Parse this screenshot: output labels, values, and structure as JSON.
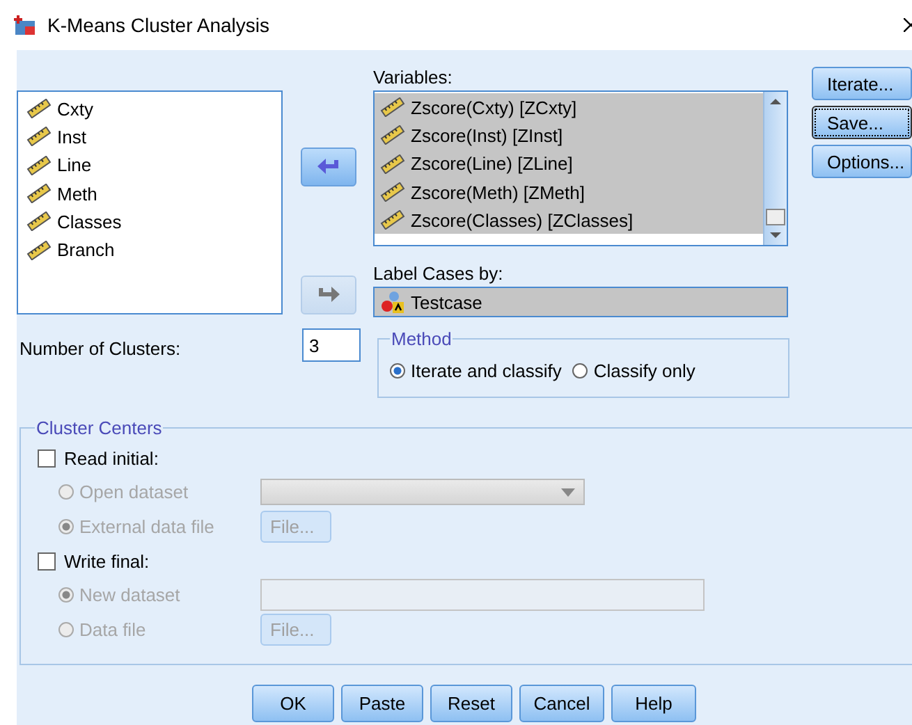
{
  "window": {
    "title": "K-Means Cluster Analysis"
  },
  "source_variables": [
    {
      "name": "Cxty"
    },
    {
      "name": "Inst"
    },
    {
      "name": "Line"
    },
    {
      "name": "Meth"
    },
    {
      "name": "Classes"
    },
    {
      "name": "Branch"
    }
  ],
  "move_buttons": [
    {
      "disabled": false
    },
    {
      "disabled": true
    }
  ],
  "variables": {
    "label": "Variables:",
    "items": [
      {
        "name": "Zscore(Cxty) [ZCxty]",
        "selected": true
      },
      {
        "name": "Zscore(Inst) [ZInst]",
        "selected": true
      },
      {
        "name": "Zscore(Line) [ZLine]",
        "selected": true
      },
      {
        "name": "Zscore(Meth) [ZMeth]",
        "selected": true
      },
      {
        "name": "Zscore(Classes) [ZClasses]",
        "selected": true
      }
    ]
  },
  "label_cases": {
    "label": "Label Cases by:",
    "value": "Testcase"
  },
  "side_buttons": [
    {
      "label": "Iterate...",
      "focused": false
    },
    {
      "label": "Save...",
      "focused": true
    },
    {
      "label": "Options...",
      "focused": false
    }
  ],
  "number_of_clusters": {
    "label": "Number of Clusters:",
    "value": "3"
  },
  "method": {
    "title": "Method",
    "options": [
      {
        "label": "Iterate and classify",
        "selected": true
      },
      {
        "label": "Classify only",
        "selected": false
      }
    ]
  },
  "cluster_centers": {
    "title": "Cluster Centers",
    "groups": [
      {
        "label": "Read initial:",
        "checked": false,
        "options": [
          {
            "label": "Open dataset",
            "selected": false,
            "disabled": true,
            "kind": "dropdown"
          },
          {
            "label": "External data file",
            "selected": true,
            "disabled": true,
            "kind": "file",
            "button": "File..."
          }
        ]
      },
      {
        "label": "Write final:",
        "checked": false,
        "options": [
          {
            "label": "New dataset",
            "selected": true,
            "disabled": true,
            "kind": "text"
          },
          {
            "label": "Data file",
            "selected": false,
            "disabled": true,
            "kind": "file",
            "button": "File..."
          }
        ]
      }
    ]
  },
  "buttons": [
    "OK",
    "Paste",
    "Reset",
    "Cancel",
    "Help"
  ]
}
